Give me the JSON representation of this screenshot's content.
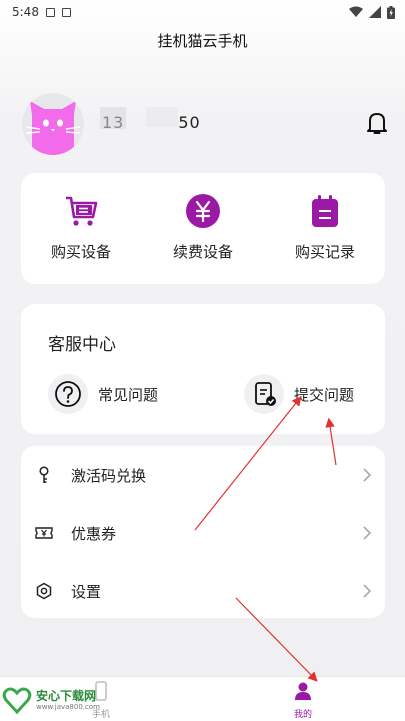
{
  "status_bar": {
    "time": "5:48"
  },
  "header": {
    "title": "挂机猫云手机"
  },
  "profile": {
    "phone_prefix": "13",
    "phone_suffix": "50"
  },
  "actions": [
    {
      "label": "购买设备",
      "icon": "cart-icon"
    },
    {
      "label": "续费设备",
      "icon": "yuan-icon"
    },
    {
      "label": "购买记录",
      "icon": "clipboard-icon"
    }
  ],
  "service": {
    "title": "客服中心",
    "items": [
      {
        "label": "常见问题",
        "icon": "question-icon"
      },
      {
        "label": "提交问题",
        "icon": "submit-doc-icon"
      }
    ]
  },
  "menu": [
    {
      "label": "激活码兑换",
      "icon": "key-icon"
    },
    {
      "label": "优惠券",
      "icon": "coupon-icon"
    },
    {
      "label": "设置",
      "icon": "gear-icon"
    }
  ],
  "tabbar": {
    "tabs": [
      {
        "label": "手机"
      },
      {
        "label": "我的"
      }
    ]
  },
  "watermark": {
    "title": "安心下载网",
    "url": "www.java800.com"
  },
  "colors": {
    "accent": "#9a1aa6",
    "avatar": "#f26bea"
  }
}
